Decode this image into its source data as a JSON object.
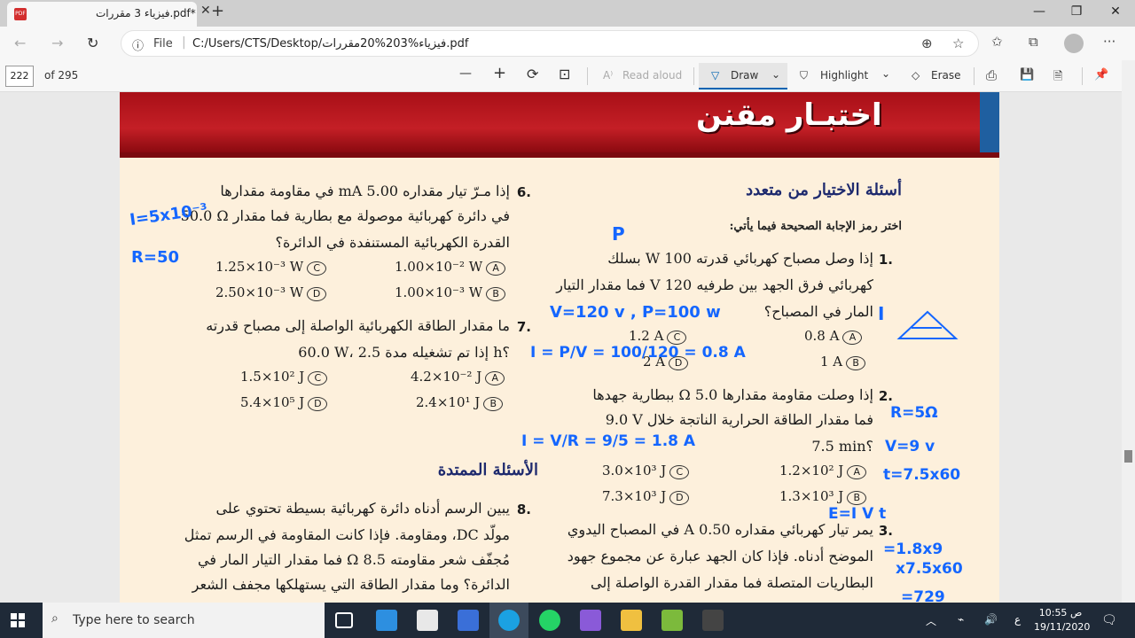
{
  "browser": {
    "tab_title": "فيزياء 3 مقررات.pdf*",
    "tab_close": "✕",
    "new_tab": "+",
    "win_min": "—",
    "win_max": "❐",
    "win_close": "✕",
    "back": "←",
    "forward": "→",
    "refresh": "↻",
    "info": "ⓘ",
    "file_label": "File",
    "url": "C:/Users/CTS/Desktop/فيزياء%203%20مقررات.pdf",
    "zoom_icon": "⊕",
    "star_icon": "☆",
    "fav_icon": "✩",
    "collections_icon": "⧉",
    "more_icon": "···"
  },
  "pdf_toolbar": {
    "page_number": "222",
    "page_total": "of 295",
    "zoom_out": "—",
    "zoom_in": "+",
    "rotate": "⟳",
    "fit": "⊡",
    "read_aloud": "Read aloud",
    "draw": "Draw",
    "highlight": "Highlight",
    "erase": "Erase",
    "print": "⎙",
    "save": "💾",
    "save_as": "🗎",
    "pin": "📌"
  },
  "document": {
    "banner_title": "اختبـار مقنن",
    "section_mc": "أسئلة الاختيار من متعدد",
    "instruction": "اختر رمز الإجابة الصحيحة فيما يأتي:",
    "section_extended": "الأسئلة الممتدة",
    "q1_num": "1.",
    "q1_l1": "إذا وصل مصباح كهربائي قدرته 100 W بسلك",
    "q1_l2": "كهربائي فرق الجهد بين طرفيه 120 V فما مقدار التيار",
    "q1_l3": "المار في المصباح؟",
    "q1_a": "0.8 A",
    "q1_b": "1 A",
    "q1_c": "1.2 A",
    "q1_d": "2 A",
    "q2_num": "2.",
    "q2_l1": "إذا وصلت مقاومة مقدارها 5.0 Ω ببطارية جهدها",
    "q2_l2": "9.0 V فما مقدار الطاقة الحرارية الناتجة خلال",
    "q2_l3": "7.5 min؟",
    "q2_a": "1.2×10² J",
    "q2_b": "1.3×10³ J",
    "q2_c": "3.0×10³ J",
    "q2_d": "7.3×10³ J",
    "q3_num": "3.",
    "q3_l1": "يمر تيار كهربائي مقداره 0.50 A في المصباح اليدوي",
    "q3_l2": "الموضح أدناه. فإذا كان الجهد عبارة عن مجموع جهود",
    "q3_l3": "البطاريات المتصلة فما مقدار القدرة الواصلة إلى",
    "q6_num": "6.",
    "q6_l1": "إذا مـرّ تيار مقداره 5.00 mA في مقاومة مقدارها",
    "q6_l2": "50.0 Ω في دائرة كهربائية موصولة مع بطارية فما مقدار",
    "q6_l3": "القدرة الكهربائية المستنفدة في الدائرة؟",
    "q6_a": "1.00×10⁻² W",
    "q6_b": "1.00×10⁻³ W",
    "q6_c": "1.25×10⁻³ W",
    "q6_d": "2.50×10⁻³ W",
    "q7_num": "7.",
    "q7_l1": "ما مقدار الطاقة الكهربائية الواصلة إلى مصباح قدرته",
    "q7_l2": "60.0 W، إذا تم تشغيله مدة 2.5 h؟",
    "q7_a": "4.2×10⁻² J",
    "q7_b": "2.4×10¹ J",
    "q7_c": "1.5×10² J",
    "q7_d": "5.4×10⁵ J",
    "q8_num": "8.",
    "q8_l1": "يبين الرسم أدناه دائرة كهربائية بسيطة تحتوي على",
    "q8_l2": "مولّد DC، ومقاومة. فإذا كانت المقاومة في الرسم تمثل",
    "q8_l3": "مُجفّف شعر مقاومته 8.5 Ω فما مقدار التيار المار في",
    "q8_l4": "الدائرة؟ وما مقدار الطاقة التي يستهلكها مجفف الشعر",
    "opt_a": "A",
    "opt_b": "B",
    "opt_c": "C",
    "opt_d": "D"
  },
  "ink": {
    "n1": "I=5x10⁻³",
    "n2": "R=50",
    "n3": "P",
    "n4": "V=120 v , P=100 w",
    "n5": "I",
    "n6": "I = P/V = 100/120 = 0.8 A",
    "n7": "I = V/R = 9/5 = 1.8 A",
    "n8": "R=5Ω",
    "n9": "V=9 v",
    "n10": "t=7.5x60",
    "n11": "E=I V t",
    "n12": "=1.8x9",
    "n13": "x7.5x60",
    "n14": "=729"
  },
  "taskbar": {
    "search_placeholder": "Type here to search",
    "time": "10:55 ص",
    "date": "19/11/2020",
    "lang": "ع"
  },
  "colors": {
    "banner_red": "#c41f26",
    "ink_blue": "#1466ff",
    "heading_navy": "#1e2a6e",
    "page_bg": "#fdf0dc"
  }
}
